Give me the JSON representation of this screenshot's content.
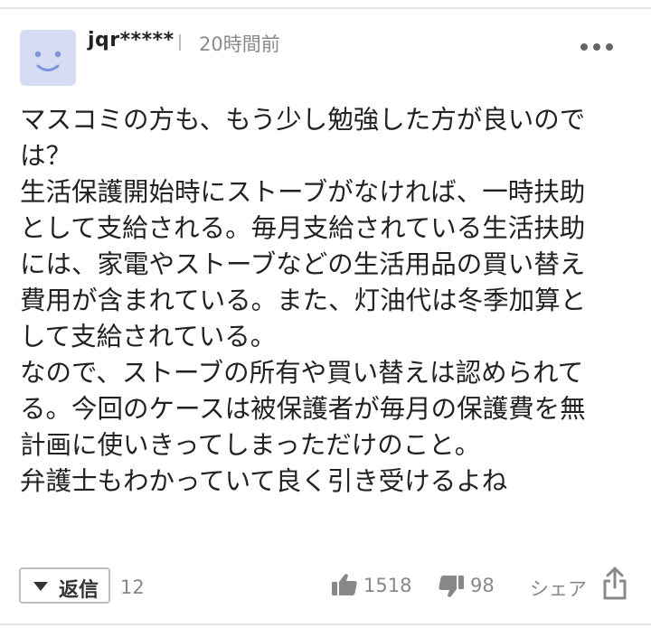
{
  "comment": {
    "username": "jqr*****",
    "timestamp": "20時間前",
    "avatar_icon": "smiley-face-icon",
    "more_icon": "more-dots-icon",
    "body_lines": [
      "マスコミの方も、もう少し勉強した方が良いので",
      "は？",
      "生活保護開始時にストーブがなければ、一時扶助",
      "として支給される。毎月支給されている生活扶助",
      "には、家電やストーブなどの生活用品の買い替え",
      "費用が含まれている。また、灯油代は冬季加算と",
      "して支給されている。",
      "なので、ストーブの所有や買い替えは認められて",
      "る。今回のケースは被保護者が毎月の保護費を無",
      "計画に使いきってしまっただけのこと。",
      "弁護士もわかっていて良く引き受けるよね"
    ]
  },
  "actions": {
    "reply_label": "返信",
    "reply_count": "12",
    "like_count": "1518",
    "dislike_count": "98",
    "share_label": "シェア"
  },
  "colors": {
    "avatar_bg": "#d6dcf3",
    "avatar_face": "#7f92dc",
    "text": "#222222",
    "muted": "#888888",
    "border": "#bfbfbf"
  }
}
